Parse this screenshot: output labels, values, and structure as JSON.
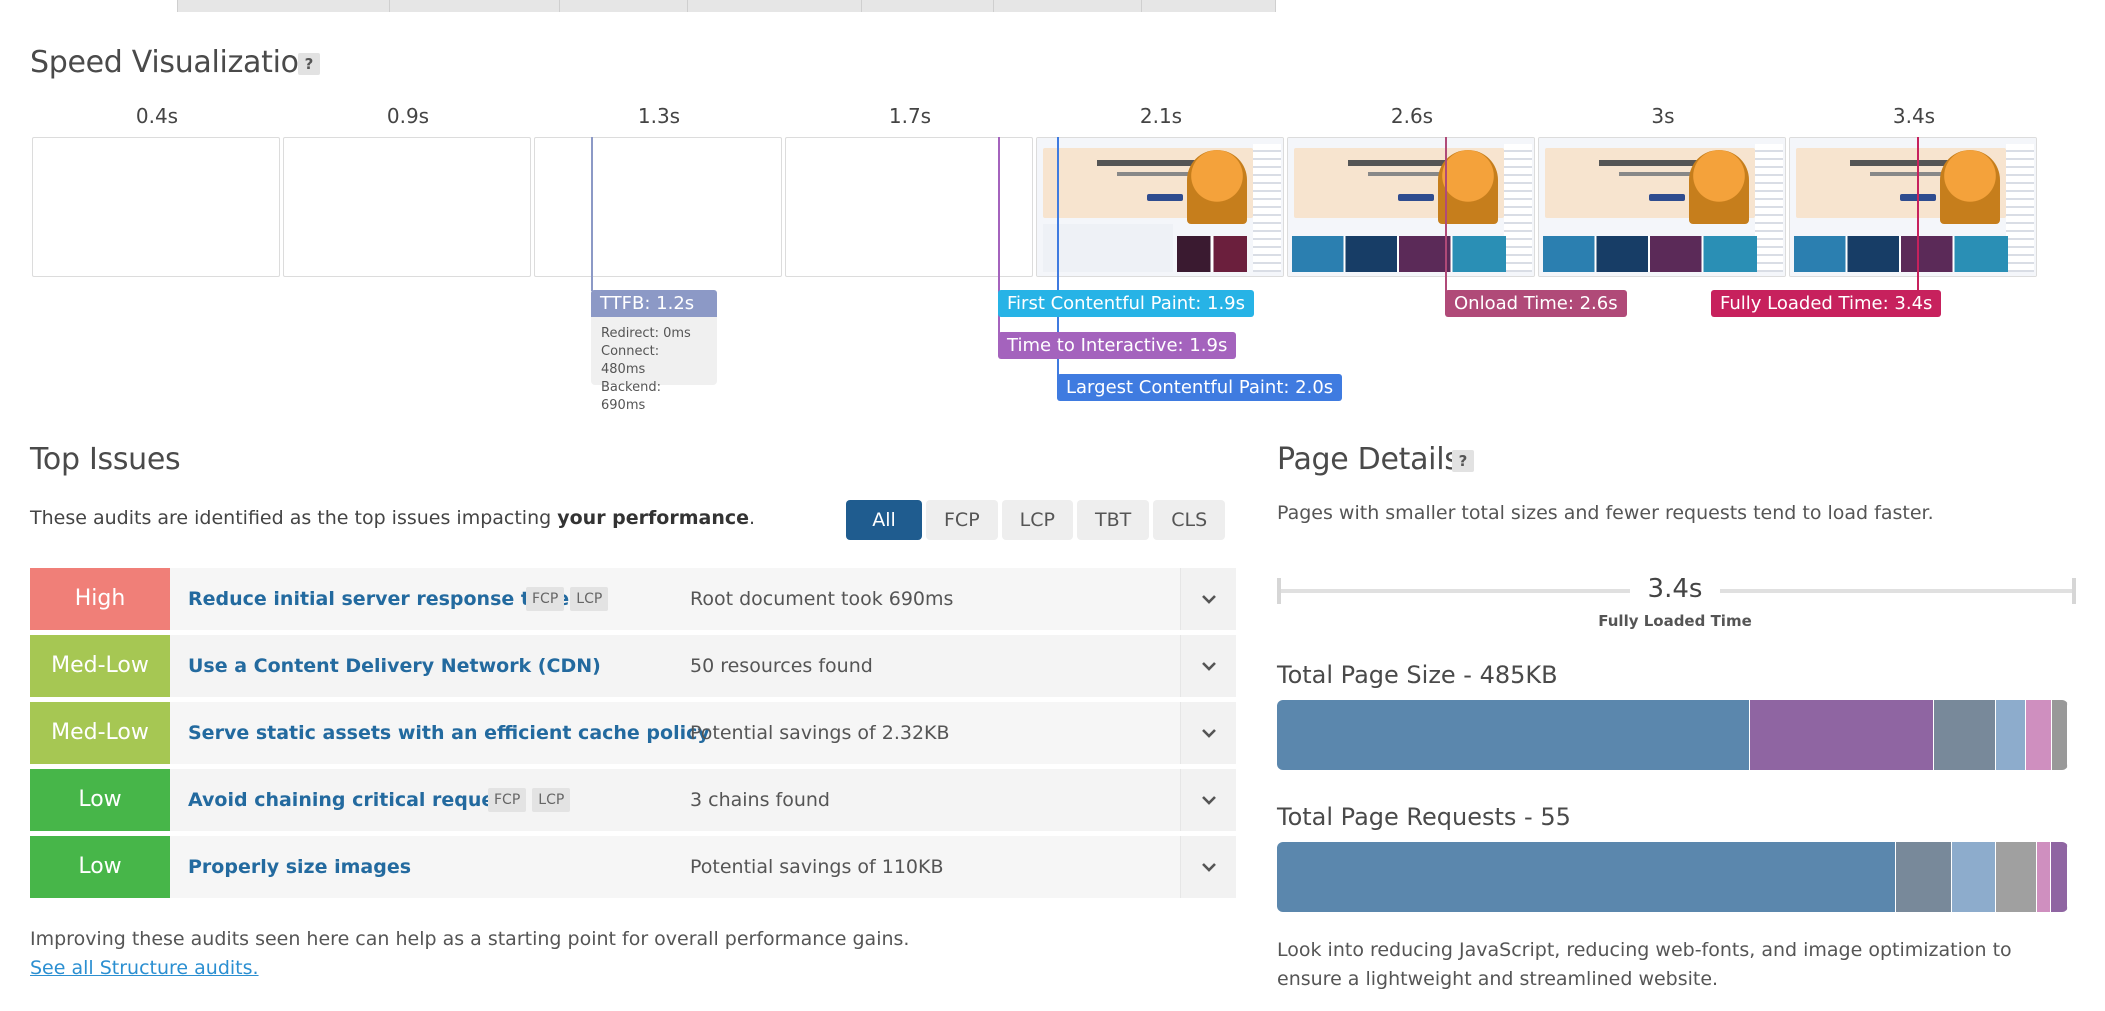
{
  "speed_visualization": {
    "title": "Speed Visualization",
    "help": "?",
    "times": [
      "0.4s",
      "0.9s",
      "1.3s",
      "1.7s",
      "2.1s",
      "2.6s",
      "3s",
      "3.4s"
    ],
    "markers": {
      "ttfb": {
        "label": "TTFB: 1.2s",
        "color": "#8c99c6"
      },
      "ttfb_details": [
        "Redirect: 0ms",
        "Connect: 480ms",
        "Backend: 690ms"
      ],
      "fcp": {
        "label": "First Contentful Paint: 1.9s",
        "color": "#27b3e6"
      },
      "tti": {
        "label": "Time to Interactive: 1.9s",
        "color": "#a463bd"
      },
      "lcp": {
        "label": "Largest Contentful Paint: 2.0s",
        "color": "#3f7be0"
      },
      "onload": {
        "label": "Onload Time: 2.6s",
        "color": "#b04a78"
      },
      "fully_loaded": {
        "label": "Fully Loaded Time: 3.4s",
        "color": "#c7215d"
      }
    }
  },
  "top_issues": {
    "title": "Top Issues",
    "desc_prefix": "These audits are identified as the top issues impacting ",
    "desc_bold": "your performance",
    "desc_suffix": ".",
    "filters": [
      "All",
      "FCP",
      "LCP",
      "TBT",
      "CLS"
    ],
    "active_filter": "All",
    "rows": [
      {
        "priority": "High",
        "color": "#f07f78",
        "title": "Reduce initial server response time",
        "chips": [
          "FCP",
          "LCP"
        ],
        "detail": "Root document took 690ms"
      },
      {
        "priority": "Med-Low",
        "color": "#a6c753",
        "title": "Use a Content Delivery Network (CDN)",
        "chips": [],
        "detail": "50 resources found"
      },
      {
        "priority": "Med-Low",
        "color": "#a6c753",
        "title": "Serve static assets with an efficient cache policy",
        "chips": [],
        "detail": "Potential savings of 2.32KB"
      },
      {
        "priority": "Low",
        "color": "#47b649",
        "title": "Avoid chaining critical requests",
        "chips": [
          "FCP",
          "LCP"
        ],
        "detail": "3 chains found"
      },
      {
        "priority": "Low",
        "color": "#47b649",
        "title": "Properly size images",
        "chips": [],
        "detail": "Potential savings of 110KB"
      }
    ],
    "footer": "Improving these audits seen here can help as a starting point for overall performance gains.",
    "link": "See all Structure audits."
  },
  "page_details": {
    "title": "Page Details",
    "help": "?",
    "desc": "Pages with smaller total sizes and fewer requests tend to load faster.",
    "fully_loaded_value": "3.4s",
    "fully_loaded_label": "Fully Loaded Time",
    "size_title": "Total Page Size - 485KB",
    "size_segments": [
      {
        "share": 0.598,
        "color": "#5b87ad"
      },
      {
        "share": 0.233,
        "color": "#8f65a2"
      },
      {
        "share": 0.078,
        "color": "#78899a"
      },
      {
        "share": 0.038,
        "color": "#8daccc"
      },
      {
        "share": 0.033,
        "color": "#cf8fbf"
      },
      {
        "share": 0.02,
        "color": "#999999"
      }
    ],
    "requests_title": "Total Page Requests - 55",
    "request_segments": [
      {
        "share": 0.782,
        "color": "#5b87ad"
      },
      {
        "share": 0.072,
        "color": "#78899a"
      },
      {
        "share": 0.055,
        "color": "#8daccc"
      },
      {
        "share": 0.052,
        "color": "#a0a0a0"
      },
      {
        "share": 0.017,
        "color": "#cf8fbf"
      },
      {
        "share": 0.022,
        "color": "#8f65a2"
      }
    ],
    "footer": "Look into reducing JavaScript, reducing web-fonts, and image optimization to ensure a lightweight and streamlined website."
  }
}
